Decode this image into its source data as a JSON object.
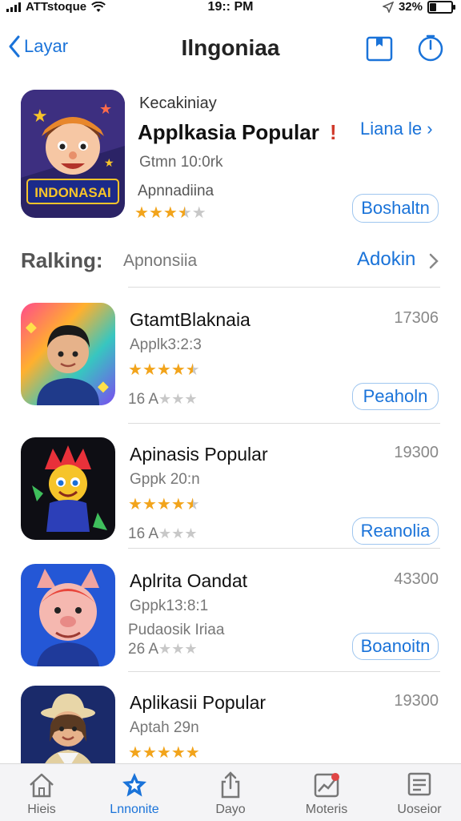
{
  "status_bar": {
    "carrier": "ATTstoque",
    "time": "19:: PM",
    "battery": "32%"
  },
  "nav": {
    "back_label": "Layar",
    "title": "Ilngoniaa"
  },
  "featured": {
    "subtitle": "Kecakiniay",
    "title": "Applkasia Popular",
    "exclaim": "!",
    "link": "Liana le",
    "developer": "Gtmn 10:0rk",
    "category": "Apnnadiina",
    "rating": 3.5,
    "icon_text": "INDONASAI",
    "button": "Boshaltn"
  },
  "section": {
    "title": "Ralking:",
    "subtitle": "Apnonsiia",
    "link": "Adokin"
  },
  "apps": [
    {
      "name": "GtamtBlaknaia",
      "id": "Applk3:2:3",
      "rating": 4.5,
      "line4": "16 A",
      "line4_stars": 3,
      "number": "17306",
      "button": "Peaholn"
    },
    {
      "name": "Apinasis Popular",
      "id": "Gppk 20:n",
      "rating": 4.5,
      "line4": "16 A",
      "line4_stars": 3,
      "number": "19300",
      "button": "Reanolia"
    },
    {
      "name": "Aplrita Oandat",
      "id": "Gppk13:8:1",
      "sub": "Pudaosik Iriaa",
      "rating": 0,
      "line4": "26 A",
      "line4_stars": 3,
      "number": "43300",
      "button": "Boanoitn"
    },
    {
      "name": "Aplikasii Popular",
      "id": "Aptah 29n",
      "rating": 5,
      "number": "19300"
    }
  ],
  "tabs": [
    {
      "label": "Hieis",
      "icon": "home-icon",
      "active": false
    },
    {
      "label": "Lnnonite",
      "icon": "star-icon",
      "active": true
    },
    {
      "label": "Dayo",
      "icon": "share-icon",
      "active": false
    },
    {
      "label": "Moteris",
      "icon": "chart-icon",
      "active": false
    },
    {
      "label": "Uoseior",
      "icon": "list-icon",
      "active": false
    }
  ],
  "colors": {
    "accent": "#1a73d9",
    "star": "#f2a41b",
    "star_empty": "#c8c8c8"
  }
}
